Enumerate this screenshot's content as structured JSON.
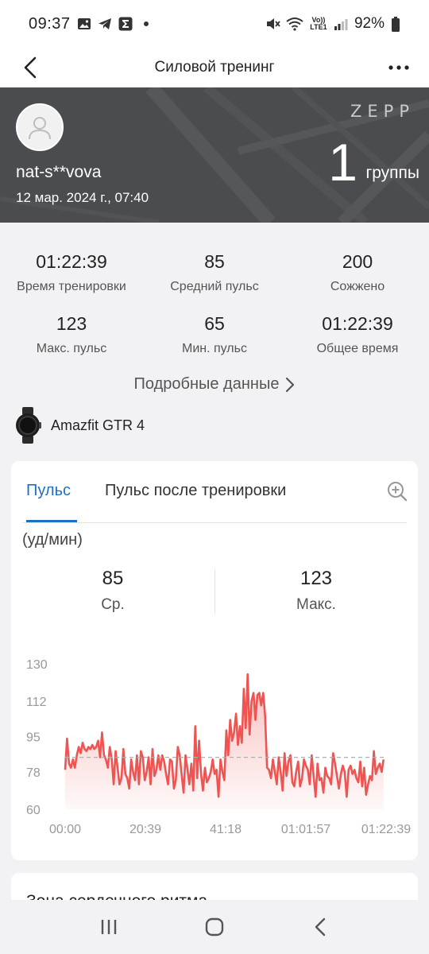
{
  "status_bar": {
    "time": "09:37",
    "battery": "92%",
    "network_label": "Vo)) LTE1"
  },
  "header": {
    "title": "Силовой тренинг"
  },
  "hero": {
    "username": "nat-s**vova",
    "date": "12 мар. 2024 г., 07:40",
    "brand": "ZEPP",
    "groups_value": "1",
    "groups_label": "группы"
  },
  "stats": [
    {
      "value": "01:22:39",
      "label": "Время тренировки"
    },
    {
      "value": "85",
      "label": "Средний пульс"
    },
    {
      "value": "200",
      "label": "Сожжено"
    },
    {
      "value": "123",
      "label": "Макс. пульс"
    },
    {
      "value": "65",
      "label": "Мин. пульс"
    },
    {
      "value": "01:22:39",
      "label": "Общее время"
    }
  ],
  "details_link": "Подробные данные",
  "device": {
    "name": "Amazfit GTR 4"
  },
  "hr_card": {
    "tabs": [
      {
        "label": "Пульс",
        "active": true
      },
      {
        "label": "Пульс после тренировки",
        "active": false
      }
    ],
    "unit": "(уд/мин)",
    "avg": {
      "value": "85",
      "label": "Ср."
    },
    "max": {
      "value": "123",
      "label": "Макс."
    }
  },
  "chart_data": {
    "type": "area",
    "title": "",
    "xlabel": "",
    "ylabel": "(уд/мин)",
    "ylim": [
      60,
      130
    ],
    "yticks": [
      130,
      112,
      95,
      78,
      60
    ],
    "xticks": [
      "00:00",
      "20:39",
      "41:18",
      "01:01:57",
      "01:22:39"
    ],
    "x_minutes_range": [
      0,
      82.65
    ],
    "reference_line": 85,
    "colors": {
      "line": "#ee5451",
      "fill_top": "#f8bcbc",
      "reference": "#b0b0b0"
    },
    "x": [
      0,
      0.5,
      1,
      1.5,
      2,
      2.5,
      3,
      3.5,
      4,
      4.5,
      5,
      5.5,
      6,
      6.5,
      7,
      7.5,
      8,
      8.5,
      9,
      9.5,
      10,
      10.5,
      11,
      11.5,
      12,
      12.5,
      13,
      13.5,
      14,
      14.5,
      15,
      15.5,
      16,
      16.5,
      17,
      17.5,
      18,
      18.5,
      19,
      19.5,
      20,
      20.5,
      21,
      21.5,
      22,
      22.5,
      23,
      23.5,
      24,
      24.5,
      25,
      25.5,
      26,
      26.5,
      27,
      27.5,
      28,
      28.5,
      29,
      29.5,
      30,
      30.5,
      31,
      31.5,
      32,
      32.5,
      33,
      33.5,
      34,
      34.5,
      35,
      35.5,
      36,
      36.5,
      37,
      37.5,
      38,
      38.5,
      39,
      39.5,
      40,
      40.5,
      41,
      41.5,
      42,
      42.5,
      43,
      43.5,
      44,
      44.5,
      45,
      45.5,
      46,
      46.5,
      47,
      47.5,
      48,
      48.5,
      49,
      49.5,
      50,
      50.5,
      51,
      51.5,
      52,
      52.5,
      53,
      53.5,
      54,
      54.5,
      55,
      55.5,
      56,
      56.5,
      57,
      57.5,
      58,
      58.5,
      59,
      59.5,
      60,
      60.5,
      61,
      61.5,
      62,
      62.5,
      63,
      63.5,
      64,
      64.5,
      65,
      65.5,
      66,
      66.5,
      67,
      67.5,
      68,
      68.5,
      69,
      69.5,
      70,
      70.5,
      71,
      71.5,
      72,
      72.5,
      73,
      73.5,
      74,
      74.5,
      75,
      75.5,
      76,
      76.5,
      77,
      77.5,
      78,
      78.5,
      79,
      79.5,
      80,
      80.5,
      81,
      81.5,
      82
    ],
    "values": [
      79,
      94,
      82,
      80,
      84,
      80,
      86,
      90,
      87,
      92,
      89,
      88,
      90,
      89,
      91,
      89,
      90,
      93,
      85,
      97,
      86,
      84,
      80,
      90,
      84,
      72,
      88,
      80,
      72,
      75,
      89,
      77,
      75,
      70,
      84,
      78,
      74,
      86,
      72,
      88,
      85,
      74,
      78,
      85,
      72,
      89,
      76,
      79,
      86,
      79,
      86,
      83,
      77,
      72,
      84,
      83,
      70,
      74,
      90,
      86,
      77,
      68,
      86,
      79,
      72,
      82,
      69,
      100,
      75,
      93,
      77,
      69,
      80,
      73,
      75,
      78,
      84,
      77,
      79,
      66,
      84,
      78,
      74,
      98,
      86,
      103,
      93,
      97,
      106,
      91,
      100,
      92,
      118,
      99,
      125,
      96,
      112,
      116,
      103,
      115,
      116,
      110,
      116,
      105,
      80,
      79,
      75,
      84,
      78,
      72,
      85,
      78,
      69,
      87,
      76,
      83,
      86,
      73,
      71,
      78,
      83,
      71,
      75,
      84,
      81,
      79,
      72,
      86,
      76,
      66,
      82,
      74,
      75,
      68,
      80,
      76,
      75,
      72,
      87,
      82,
      76,
      70,
      77,
      81,
      78,
      66,
      79,
      81,
      77,
      79,
      75,
      73,
      83,
      71,
      80,
      67,
      72,
      76,
      74,
      88,
      77,
      80,
      82,
      78,
      84,
      79
    ]
  },
  "zone_card": {
    "title": "Зона сердечного ритма"
  }
}
